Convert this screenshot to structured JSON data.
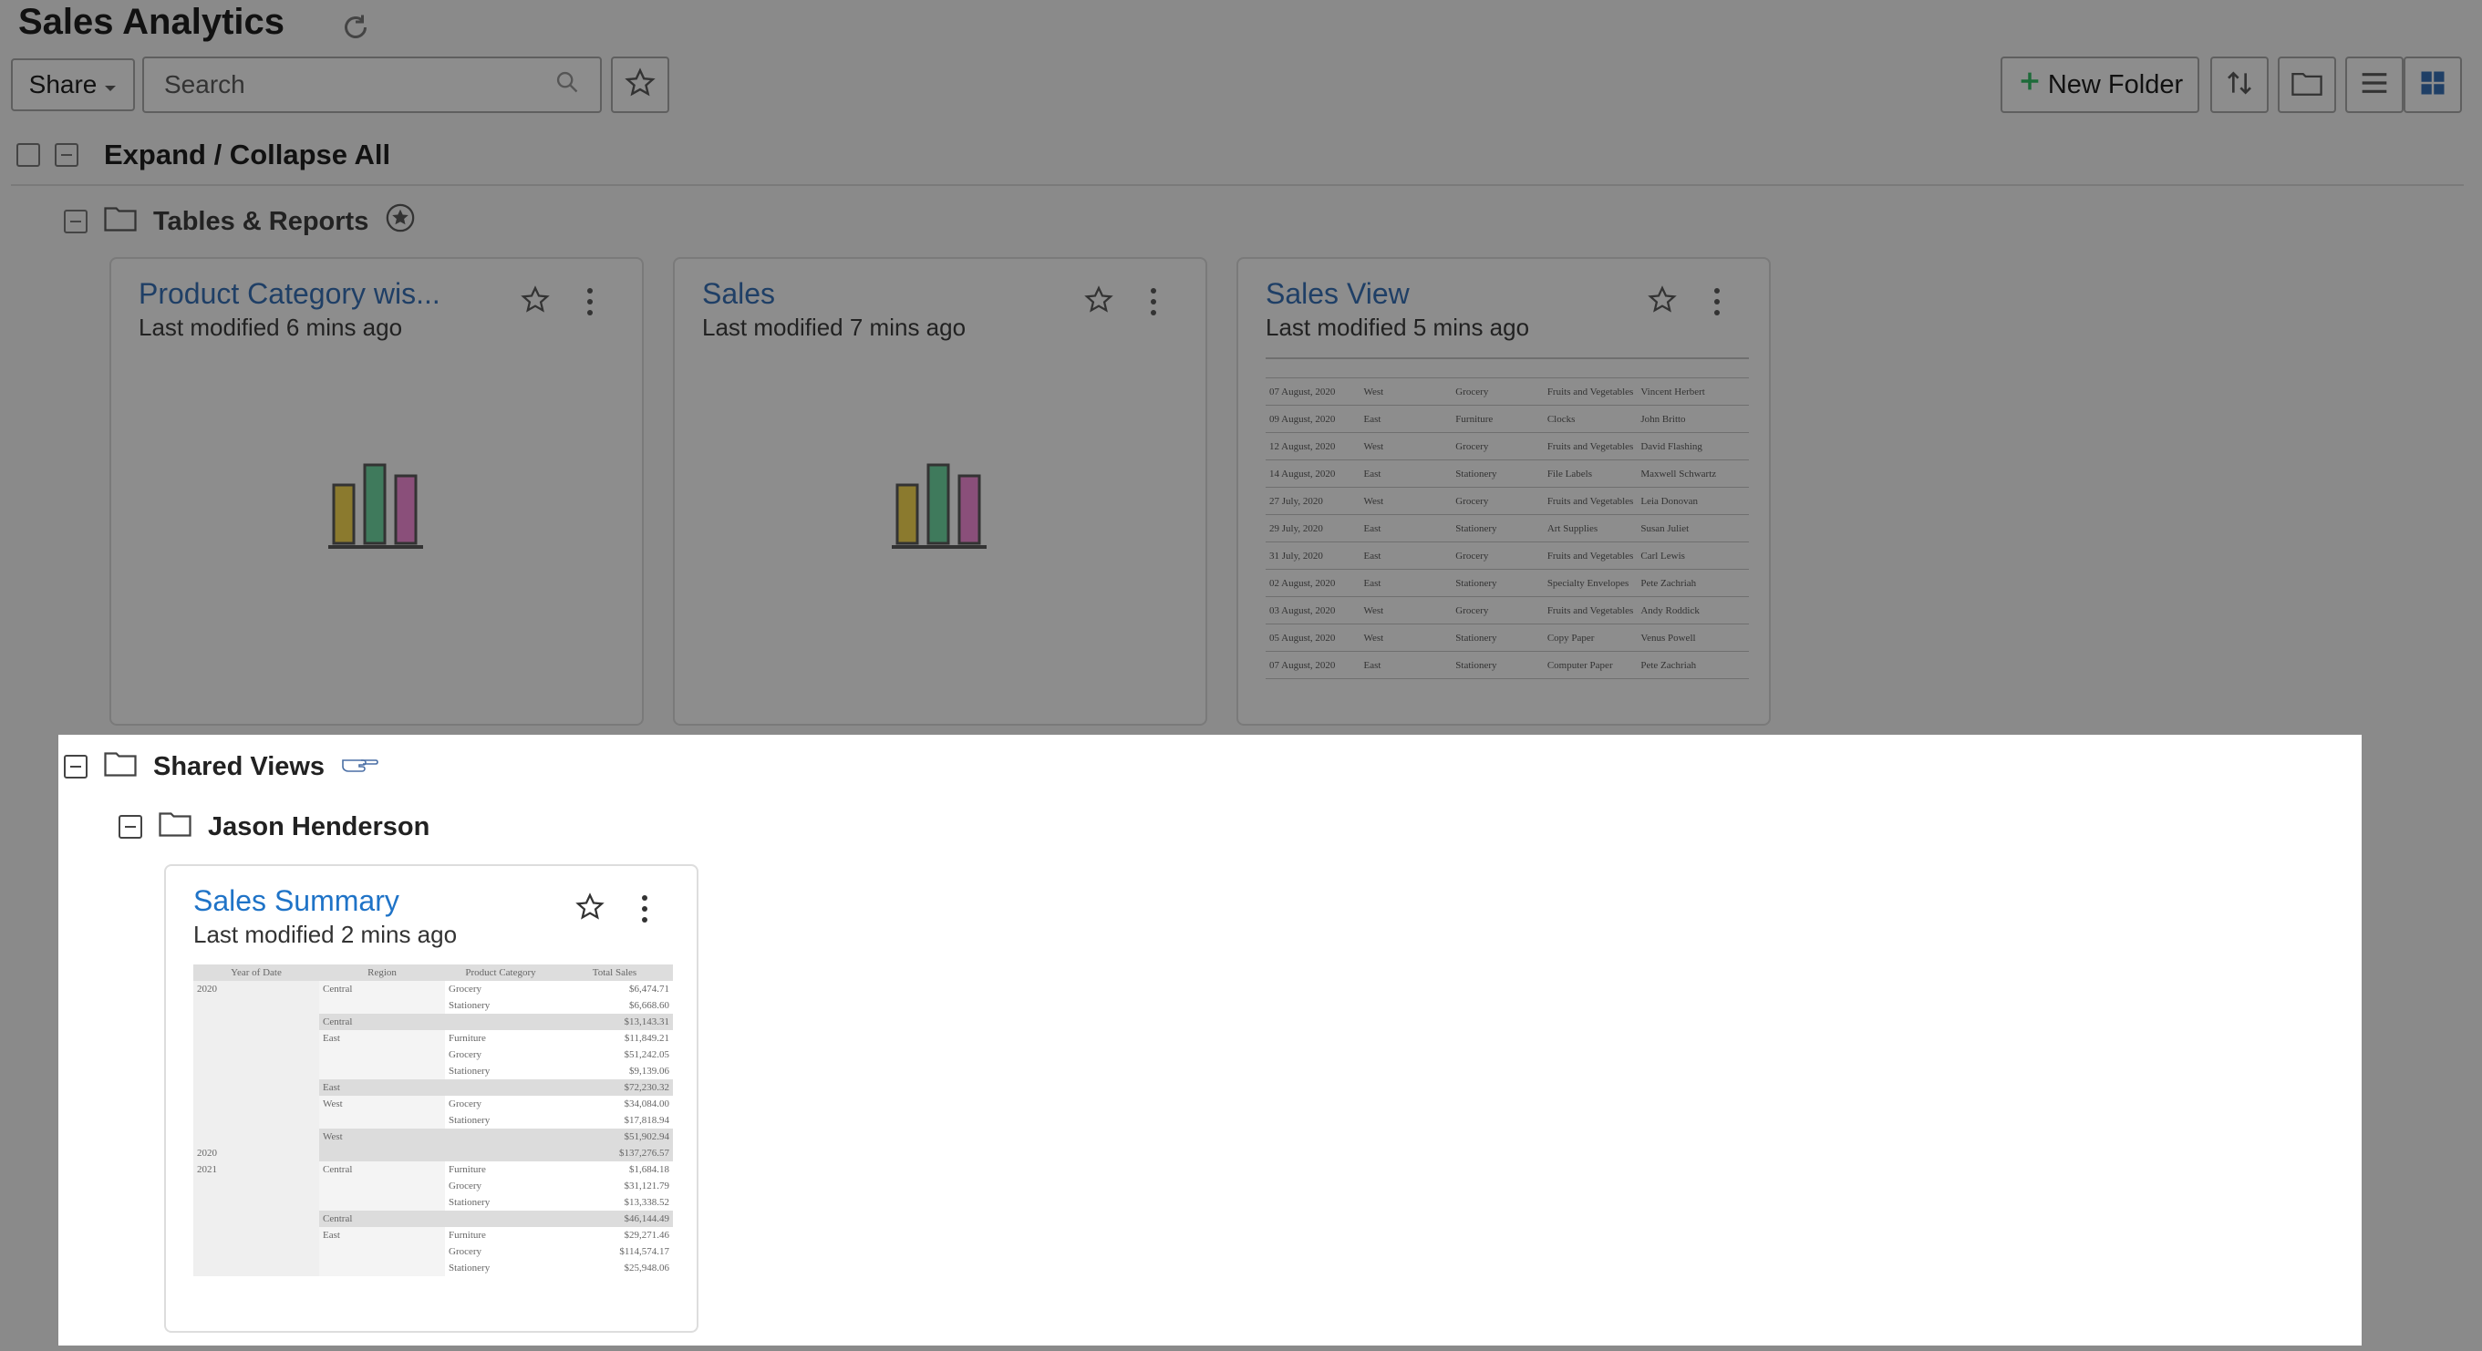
{
  "header": {
    "title": "Sales Analytics",
    "share_label": "Share",
    "search_placeholder": "Search",
    "new_folder_label": "New Folder"
  },
  "expand_all_label": "Expand / Collapse All",
  "folders": {
    "tables_reports": "Tables & Reports",
    "shared_views": "Shared Views",
    "jason": "Jason Henderson"
  },
  "cards": [
    {
      "title": "Product Category wis...",
      "modified": "Last modified 6 mins ago"
    },
    {
      "title": "Sales",
      "modified": "Last modified 7 mins ago"
    },
    {
      "title": "Sales View",
      "modified": "Last modified 5 mins ago"
    },
    {
      "title": "Sales Summary",
      "modified": "Last modified 2 mins ago"
    }
  ],
  "sales_view_rows": [
    [
      "07 August, 2020",
      "West",
      "Grocery",
      "Fruits and Vegetables",
      "Vincent Herbert"
    ],
    [
      "09 August, 2020",
      "East",
      "Furniture",
      "Clocks",
      "John Britto"
    ],
    [
      "12 August, 2020",
      "West",
      "Grocery",
      "Fruits and Vegetables",
      "David Flashing"
    ],
    [
      "14 August, 2020",
      "East",
      "Stationery",
      "File Labels",
      "Maxwell Schwartz"
    ],
    [
      "27 July, 2020",
      "West",
      "Grocery",
      "Fruits and Vegetables",
      "Leia Donovan"
    ],
    [
      "29 July, 2020",
      "East",
      "Stationery",
      "Art Supplies",
      "Susan Juliet"
    ],
    [
      "31 July, 2020",
      "East",
      "Grocery",
      "Fruits and Vegetables",
      "Carl Lewis"
    ],
    [
      "02 August, 2020",
      "East",
      "Stationery",
      "Specialty Envelopes",
      "Pete Zachriah"
    ],
    [
      "03 August, 2020",
      "West",
      "Grocery",
      "Fruits and Vegetables",
      "Andy Roddick"
    ],
    [
      "05 August, 2020",
      "West",
      "Stationery",
      "Copy Paper",
      "Venus Powell"
    ],
    [
      "07 August, 2020",
      "East",
      "Stationery",
      "Computer Paper",
      "Pete Zachriah"
    ]
  ],
  "summary_headers": [
    "Year of Date",
    "Region",
    "Product Category",
    "Total Sales"
  ],
  "summary_rows": [
    [
      "2020",
      "Central",
      "Grocery",
      "$6,474.71"
    ],
    [
      "",
      "",
      "Stationery",
      "$6,668.60"
    ],
    [
      "",
      "Central",
      "",
      "$13,143.31"
    ],
    [
      "",
      "East",
      "Furniture",
      "$11,849.21"
    ],
    [
      "",
      "",
      "Grocery",
      "$51,242.05"
    ],
    [
      "",
      "",
      "Stationery",
      "$9,139.06"
    ],
    [
      "",
      "East",
      "",
      "$72,230.32"
    ],
    [
      "",
      "West",
      "Grocery",
      "$34,084.00"
    ],
    [
      "",
      "",
      "Stationery",
      "$17,818.94"
    ],
    [
      "",
      "West",
      "",
      "$51,902.94"
    ],
    [
      "2020",
      "",
      "",
      "$137,276.57"
    ],
    [
      "2021",
      "Central",
      "Furniture",
      "$1,684.18"
    ],
    [
      "",
      "",
      "Grocery",
      "$31,121.79"
    ],
    [
      "",
      "",
      "Stationery",
      "$13,338.52"
    ],
    [
      "",
      "Central",
      "",
      "$46,144.49"
    ],
    [
      "",
      "East",
      "Furniture",
      "$29,271.46"
    ],
    [
      "",
      "",
      "Grocery",
      "$114,574.17"
    ],
    [
      "",
      "",
      "Stationery",
      "$25,948.06"
    ]
  ]
}
